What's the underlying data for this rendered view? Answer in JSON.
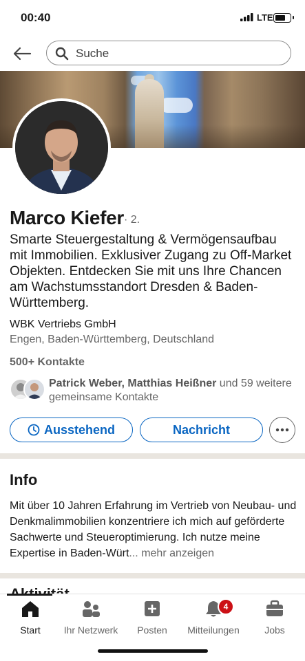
{
  "status_bar": {
    "time": "00:40",
    "network": "LTE"
  },
  "search": {
    "placeholder": "Suche"
  },
  "profile": {
    "name": "Marco Kiefer",
    "degree": "· 2.",
    "headline": "Smarte Steuergestaltung & Vermögensaufbau mit Immobilien. Exklusiver Zugang zu Off-Market Objekten. Entdecken Sie mit uns Ihre Chancen am Wachstumsstandort Dresden & Baden-Württemberg.",
    "company": "WBK Vertriebs GmbH",
    "location": "Engen, Baden-Württemberg, Deutschland",
    "connections": "500+ Kontakte",
    "mutual": {
      "names": "Patrick Weber, Matthias Heißner",
      "suffix": " und 59 weitere gemeinsame Kontakte"
    }
  },
  "actions": {
    "pending_label": "Ausstehend",
    "message_label": "Nachricht"
  },
  "info": {
    "title": "Info",
    "text": "Mit über 10 Jahren Erfahrung im Vertrieb von Neubau- und Denkmalimmobilien konzentriere ich mich auf geförderte Sachwerte und Steueroptimierung. Ich nutze meine Expertise in Baden-Würt",
    "more": "... mehr anzeigen"
  },
  "next_section_peek": "Aktivität",
  "bottom_nav": {
    "items": [
      {
        "label": "Start",
        "icon": "home-icon",
        "active": true
      },
      {
        "label": "Ihr Netzwerk",
        "icon": "network-icon"
      },
      {
        "label": "Posten",
        "icon": "post-icon"
      },
      {
        "label": "Mitteilungen",
        "icon": "bell-icon",
        "badge": "4"
      },
      {
        "label": "Jobs",
        "icon": "briefcase-icon"
      }
    ]
  },
  "colors": {
    "accent": "#0a66c2",
    "badge": "#cc1016",
    "divider": "#e9e5df"
  }
}
